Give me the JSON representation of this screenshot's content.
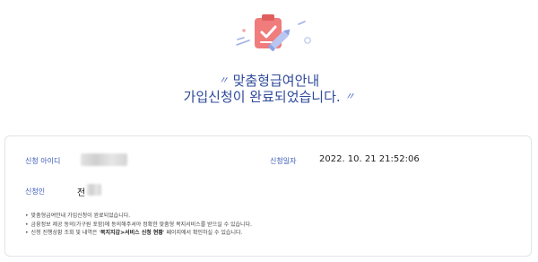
{
  "hero": {
    "icon": "checklist-pencil-icon",
    "title_line1": "맞춤형급여안내",
    "title_line2": "가입신청이 완료되었습니다.",
    "quote_open": "〃",
    "quote_close": "〃",
    "accent_color": "#2f4a9a",
    "icon_color": "#f07c7c"
  },
  "info": {
    "applicant_id_label": "신청 아이디",
    "applicant_id_value": "",
    "date_label": "신청일자",
    "date_value": "2022. 10. 21 21:52:06",
    "applicant_label": "신청인",
    "applicant_name_visible": "전"
  },
  "notes": {
    "n1": "맞춤형급여안내 가입신청이 완료되었습니다.",
    "n2": "금융정보 제공 동의(가구원 포함)에 동의해주셔야 정확한 맞춤형 복지서비스를 받으실 수 있습니다.",
    "n3_prefix": "신청 진행상황 조회 및 내역은 '",
    "n3_bold": "복지지갑>서비스 신청 현황",
    "n3_suffix": "' 페이지에서 확인하실 수 있습니다."
  }
}
